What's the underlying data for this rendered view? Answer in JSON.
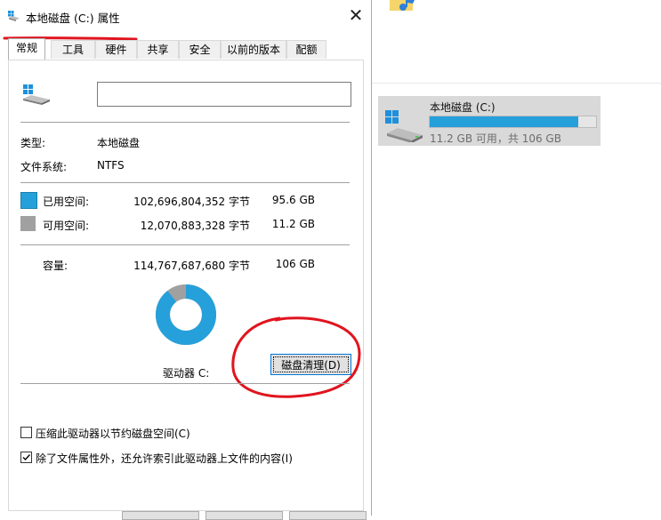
{
  "dialog": {
    "title": "本地磁盘 (C:) 属性",
    "close_glyph": "✕",
    "tabs": [
      "常规",
      "工具",
      "硬件",
      "共享",
      "安全",
      "以前的版本",
      "配额"
    ],
    "name_value": "",
    "type_label": "类型:",
    "type_value": "本地磁盘",
    "fs_label": "文件系统:",
    "fs_value": "NTFS",
    "used_label": "已用空间:",
    "used_bytes": "102,696,804,352 字节",
    "used_size": "95.6 GB",
    "free_label": "可用空间:",
    "free_bytes": "12,070,883,328 字节",
    "free_size": "11.2 GB",
    "cap_label": "容量:",
    "cap_bytes": "114,767,687,680 字节",
    "cap_size": "106 GB",
    "used_fraction": 0.895,
    "drive_label": "驱动器 C:",
    "cleanup_button": "磁盘清理(D)",
    "compress_label": "压缩此驱动器以节约磁盘空间(C)",
    "compress_checked": false,
    "index_label": "除了文件属性外，还允许索引此驱动器上文件的内容(I)",
    "index_checked": true
  },
  "explorer": {
    "drive_name": "本地磁盘 (C:)",
    "drive_free_text": "11.2 GB 可用，共 106 GB",
    "used_fraction": 0.895
  },
  "colors": {
    "used": "#26a0da",
    "free": "#a0a0a0",
    "annotation": "#e0141e",
    "accent": "#0078d7"
  }
}
